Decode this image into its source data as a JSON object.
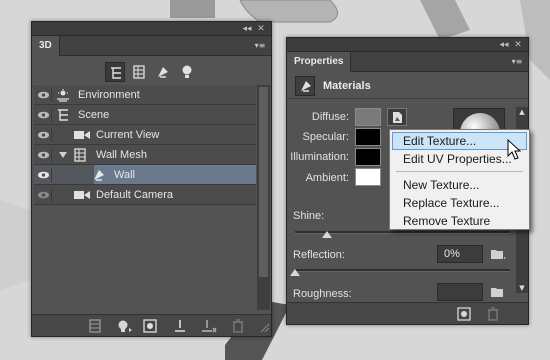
{
  "panel_3d": {
    "tab_label": "3D",
    "controls": {
      "collapse": "◂◂",
      "close": "✕",
      "menu": "▾≡"
    },
    "toolbar_icons": [
      "scene-filter-icon",
      "mesh-filter-icon",
      "material-filter-icon",
      "light-filter-icon"
    ],
    "scene_items": [
      {
        "label": "Environment",
        "icon": "environment-icon",
        "visible": true
      },
      {
        "label": "Scene",
        "icon": "scene-icon",
        "visible": true
      },
      {
        "label": "Current View",
        "icon": "camera-icon",
        "visible": true
      },
      {
        "label": "Wall Mesh",
        "icon": "mesh-icon",
        "visible": true,
        "expanded": true
      },
      {
        "label": "Wall",
        "icon": "material-icon",
        "visible": true,
        "selected": true
      },
      {
        "label": "Default Camera",
        "icon": "camera-icon",
        "visible": true
      }
    ],
    "bottom_icons": [
      "mesh-render-icon",
      "add-light-icon",
      "new-material-icon",
      "ground-icon",
      "scatter-icon",
      "trash-icon"
    ]
  },
  "panel_properties": {
    "tab_label": "Properties",
    "controls": {
      "collapse": "◂◂",
      "close": "✕",
      "menu": "▾≡"
    },
    "section_title": "Materials",
    "props": [
      {
        "label": "Diffuse:",
        "color": "#7a7a7a"
      },
      {
        "label": "Specular:",
        "color": "#000000"
      },
      {
        "label": "Illumination:",
        "color": "#000000"
      },
      {
        "label": "Ambient:",
        "color": "#ffffff"
      }
    ],
    "shine_label": "Shine:",
    "shine_value": 0.15,
    "reflection_label": "Reflection:",
    "reflection_value": "0%",
    "reflection_slider": 0.0,
    "roughness_label": "Roughness:"
  },
  "context_menu": {
    "items": [
      {
        "label": "Edit Texture...",
        "highlighted": true
      },
      {
        "label": "Edit UV Properties..."
      },
      {
        "label": "New Texture..."
      },
      {
        "label": "Replace Texture..."
      },
      {
        "label": "Remove Texture"
      }
    ]
  },
  "colors": {
    "panel_bg": "#535353",
    "selection": "#6a7a8c",
    "menu_highlight": "#cce4f7"
  }
}
